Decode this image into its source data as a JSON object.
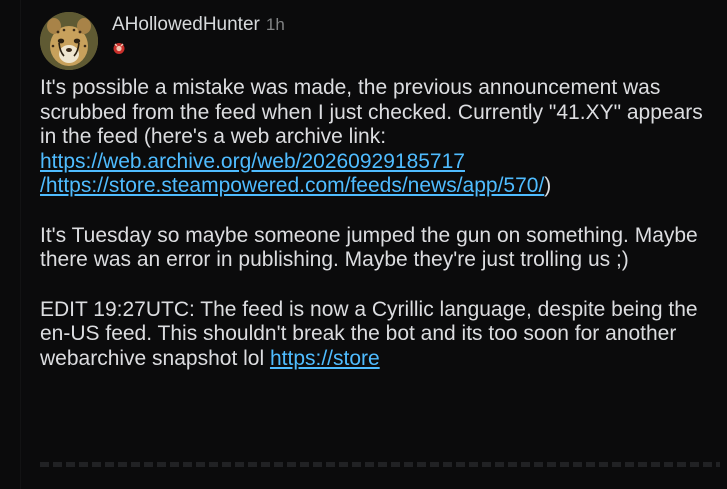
{
  "comment": {
    "author": "AHollowedHunter",
    "timestamp": "1h",
    "avatar_icon": "cheetah-avatar-icon",
    "flair_icon": "flair-emoji-icon",
    "paragraph1": {
      "text": "It's possible a mistake was made, the previous announcement was scrubbed from the feed when I just checked. Currently \"41.XY\" appears in the feed (here's a web archive link: ",
      "link_text": "https://web.archive.org/web/20260929185717/https://store.steampowered.com/feeds/news/app/570/",
      "link_part1": "https://web.archive.org/web/20260929185717",
      "link_part2": "/https://store.steampowered.com/feeds/news/app/570/",
      "suffix": ")"
    },
    "paragraph2": "It's Tuesday so maybe someone jumped the gun on something. Maybe there was an error in publishing. Maybe they're just trolling us ;)",
    "paragraph3": {
      "text": "EDIT 19:27UTC: The feed is now a Cyrillic language, despite being the en-US feed. This shouldn't break the bot and its too soon for another webarchive snapshot lol ",
      "link_text": "https://store"
    }
  },
  "colors": {
    "background": "#0b0b0c",
    "text": "#dcdde0",
    "link": "#4fbcff",
    "meta": "#818384"
  }
}
